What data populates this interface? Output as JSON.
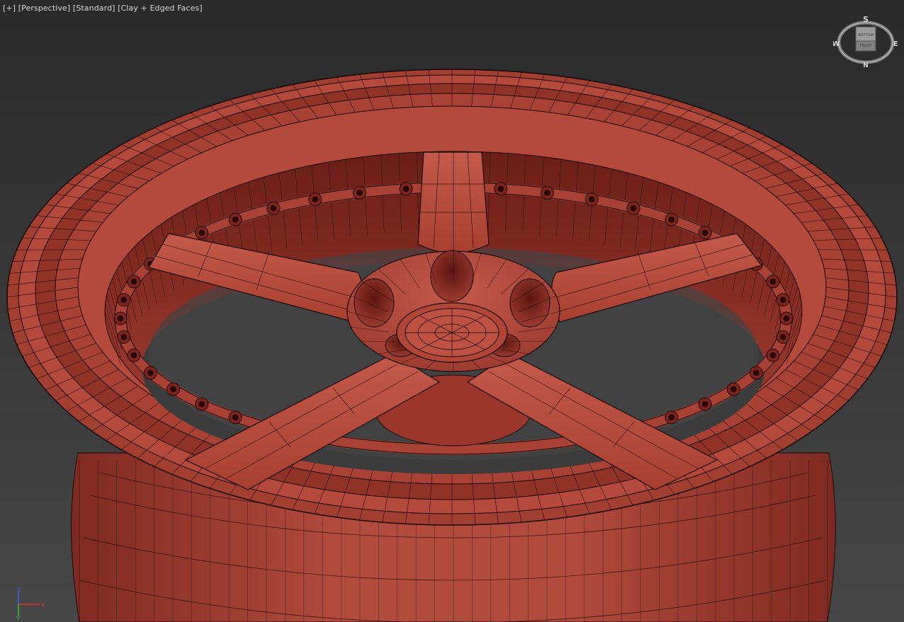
{
  "viewport": {
    "label_plus": "[+]",
    "label_view": "[Perspective]",
    "label_shading_preset": "[Standard]",
    "label_shading_mode": "[Clay + Edged Faces]"
  },
  "viewcube": {
    "north": "N",
    "south": "S",
    "east": "E",
    "west": "W",
    "face_top": "BOTTOM",
    "face_front": "FRONT"
  },
  "axis": {
    "x": "x",
    "y": "y",
    "z": "z"
  },
  "colors": {
    "background_top": "#2a2a2a",
    "background_bottom": "#474747",
    "clay": "#b44a3e",
    "clay_dark": "#7e241c",
    "wire": "#1a0605",
    "axis_x": "#e03030",
    "axis_y": "#30c030",
    "axis_z": "#4060ff"
  }
}
